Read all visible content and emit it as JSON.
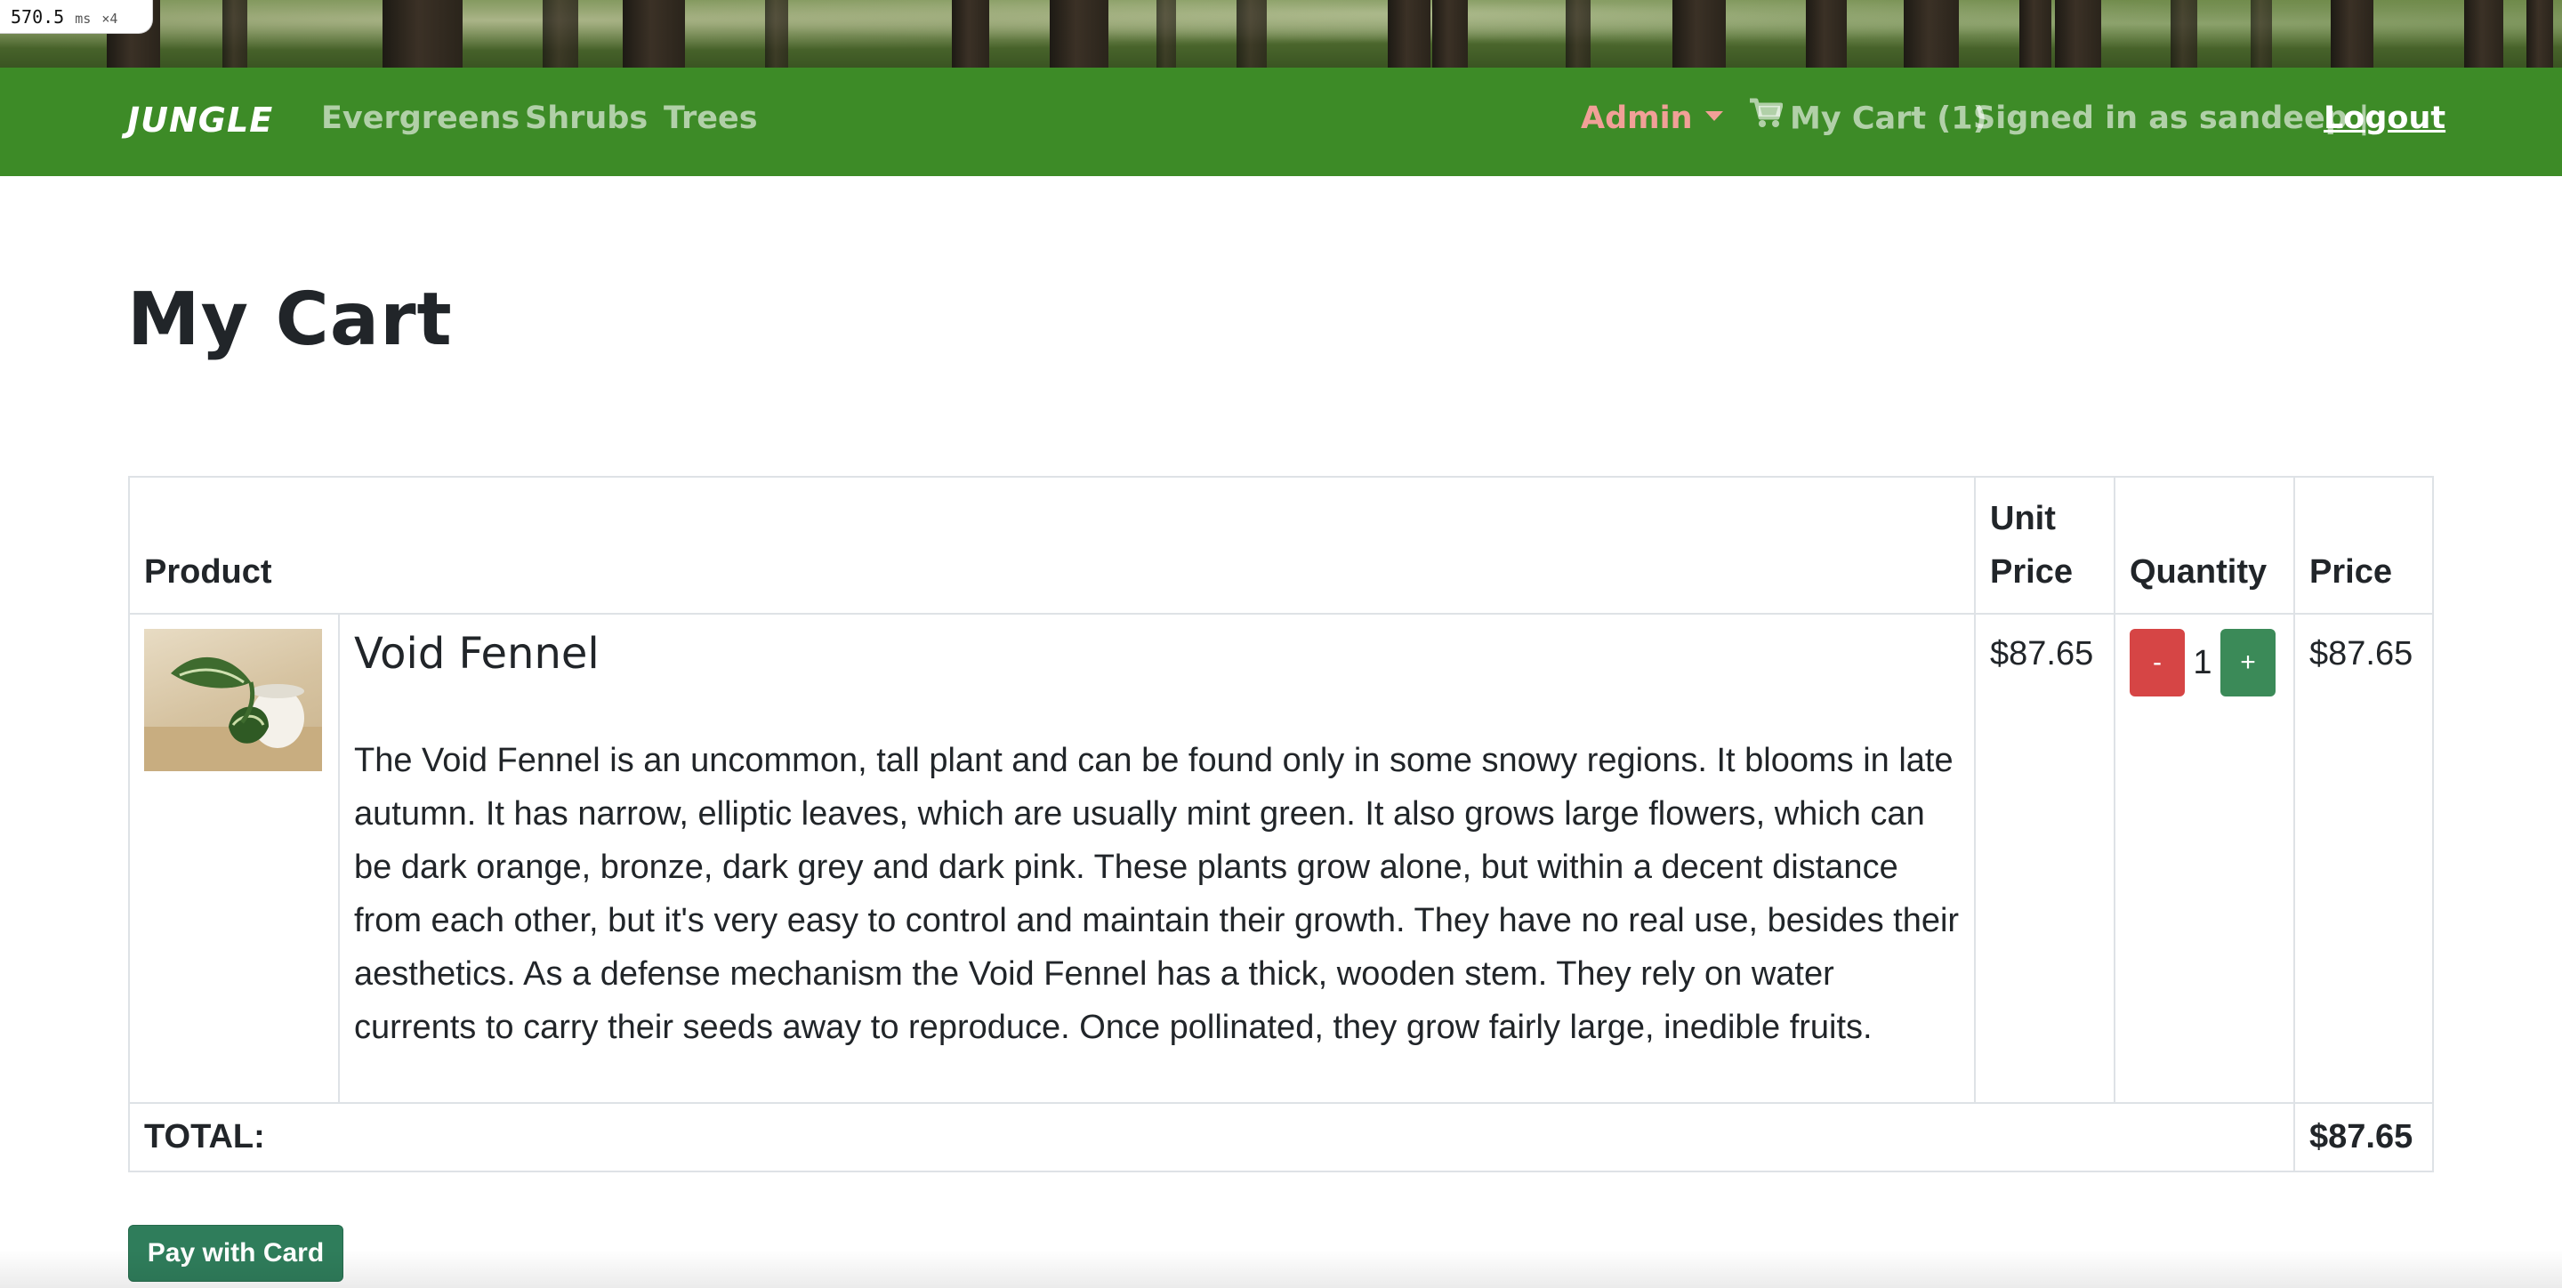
{
  "perf": {
    "value": "570.5",
    "unit": "ms",
    "multiplier": "×4"
  },
  "nav": {
    "brand": "JUNGLE",
    "links": [
      "Evergreens",
      "Shrubs",
      "Trees"
    ],
    "admin": "Admin",
    "cart": "My Cart (1)",
    "signed_in": "Signed in as sandeep |",
    "logout": "Logout"
  },
  "page": {
    "title": "My Cart"
  },
  "table": {
    "headers": {
      "product": "Product",
      "unit_price": "Unit Price",
      "quantity": "Quantity",
      "price": "Price"
    },
    "items": [
      {
        "name": "Void Fennel",
        "description": "The Void Fennel is an uncommon, tall plant and can be found only in some snowy regions. It blooms in late autumn. It has narrow, elliptic leaves, which are usually mint green. It also grows large flowers, which can be dark orange, bronze, dark grey and dark pink. These plants grow alone, but within a decent distance from each other, but it's very easy to control and maintain their growth. They have no real use, besides their aesthetics. As a defense mechanism the Void Fennel has a thick, wooden stem. They rely on water currents to carry their seeds away to reproduce. Once pollinated, they grow fairly large, inedible fruits.",
        "unit_price": "$87.65",
        "quantity": "1",
        "minus": "-",
        "plus": "+",
        "price": "$87.65"
      }
    ],
    "total_label": "TOTAL:",
    "total_value": "$87.65"
  },
  "actions": {
    "pay": "Pay with Card"
  },
  "colors": {
    "navbar": "#3d8b27",
    "admin": "#f1a097",
    "minus_button": "#d64545",
    "plus_button": "#3b8a58",
    "pay_button": "#2f7d5b"
  }
}
